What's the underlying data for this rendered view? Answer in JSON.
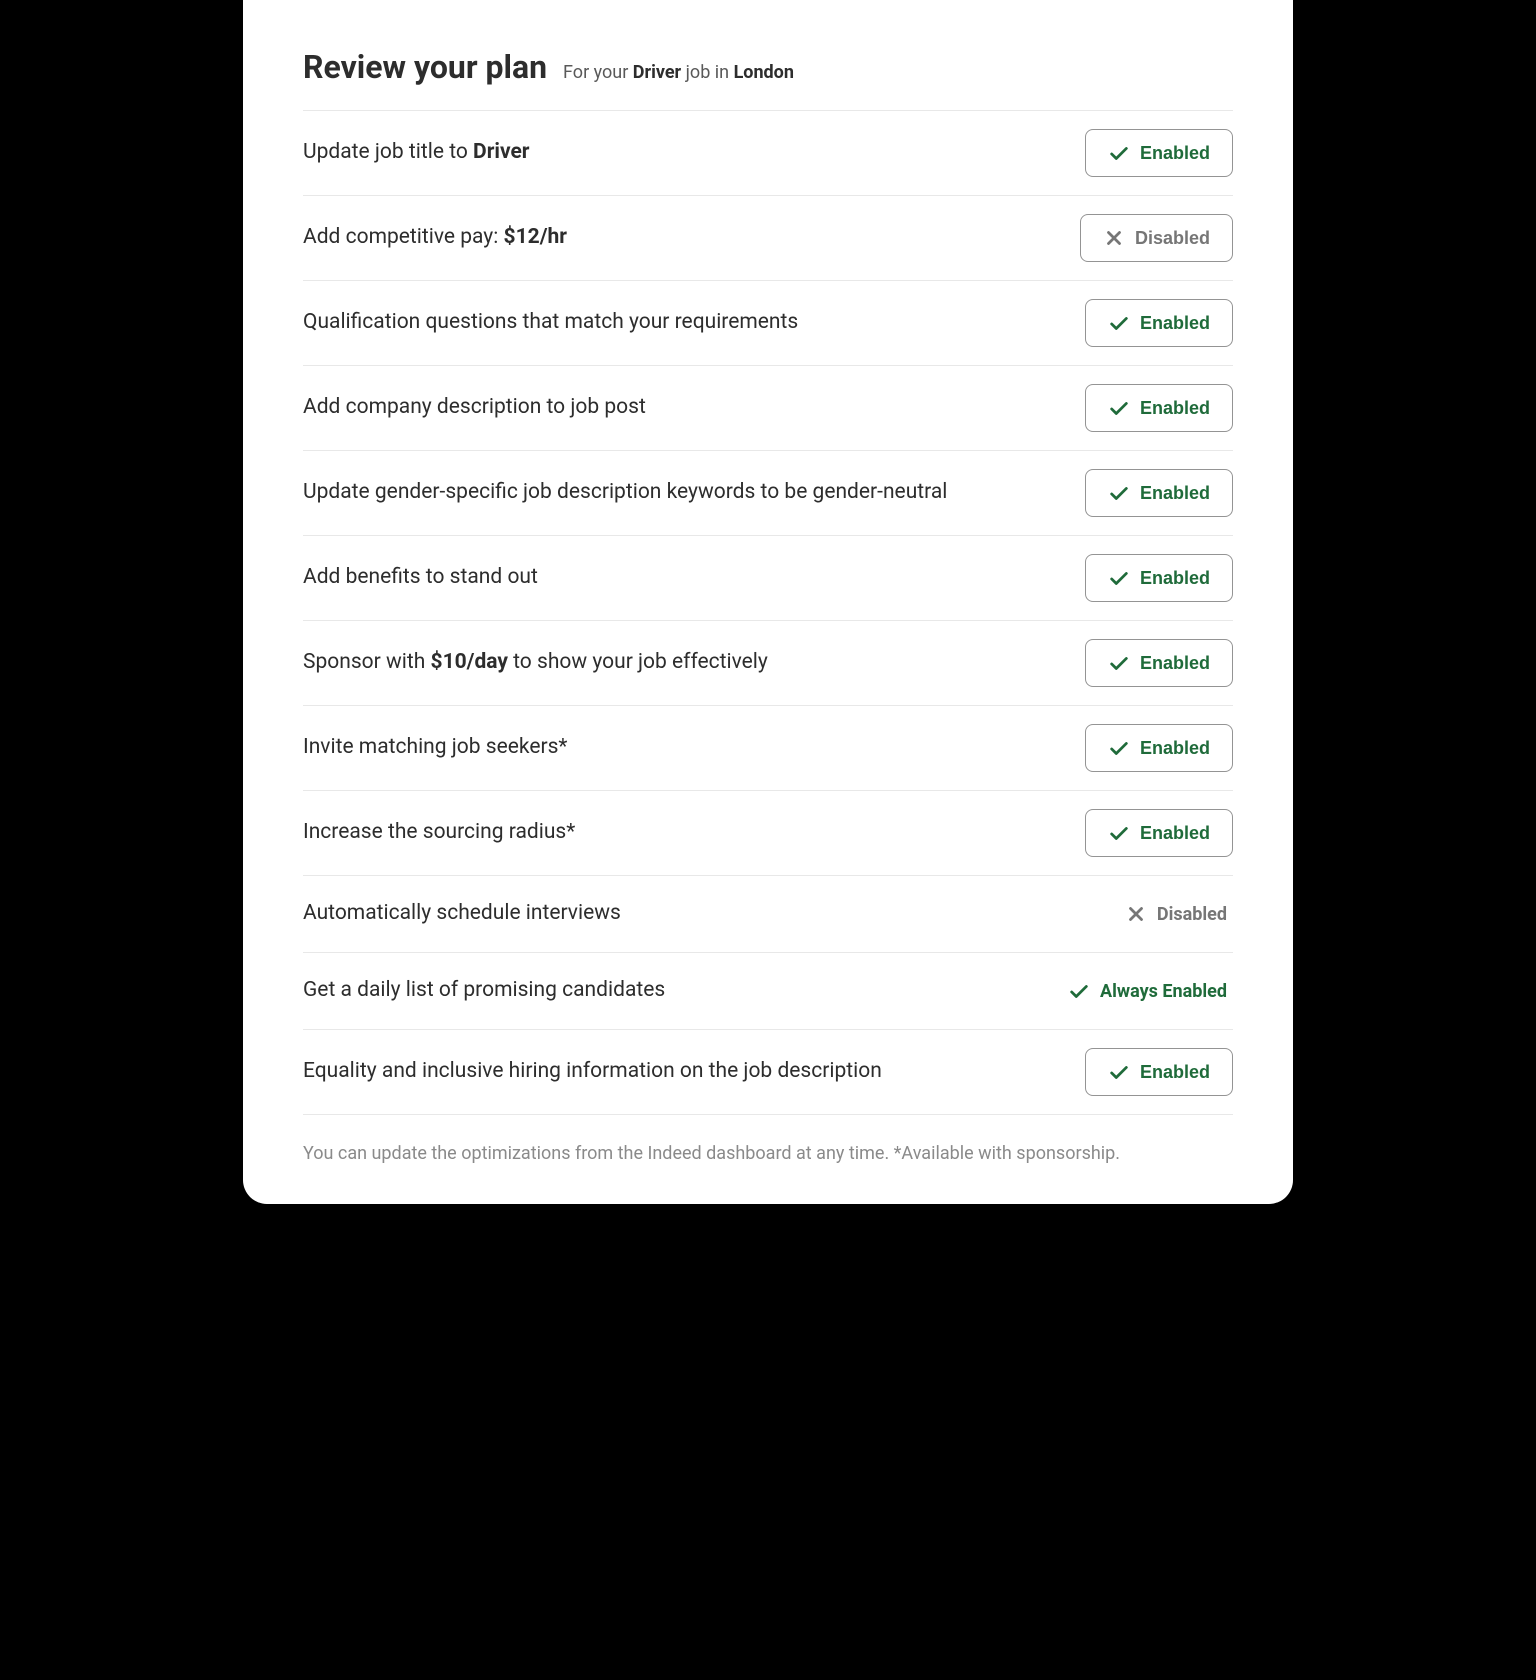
{
  "header": {
    "title": "Review your plan",
    "subtitle_prefix": "For your ",
    "subtitle_job": "Driver",
    "subtitle_mid": " job in ",
    "subtitle_location": "London"
  },
  "labels": {
    "enabled": "Enabled",
    "disabled": "Disabled",
    "always_enabled": "Always Enabled"
  },
  "rows": {
    "r0_prefix": "Update job title to ",
    "r0_bold": "Driver",
    "r1_prefix": "Add competitive pay: ",
    "r1_bold": "$12/hr",
    "r2_text": "Qualification questions that match your requirements",
    "r3_text": "Add company description to job post",
    "r4_text": "Update gender-specific job description keywords to be gender-neutral",
    "r5_text": "Add benefits to stand out",
    "r6_prefix": "Sponsor with ",
    "r6_bold": "$10/day",
    "r6_suffix": " to show your job effectively",
    "r7_text": "Invite matching job seekers*",
    "r8_text": "Increase the sourcing radius*",
    "r9_text": "Automatically schedule interviews",
    "r10_text": "Get a daily list of promising candidates",
    "r11_text": "Equality and inclusive hiring information on the job description"
  },
  "footer": "You can update the optimizations from the Indeed dashboard at any time. *Available with sponsorship."
}
